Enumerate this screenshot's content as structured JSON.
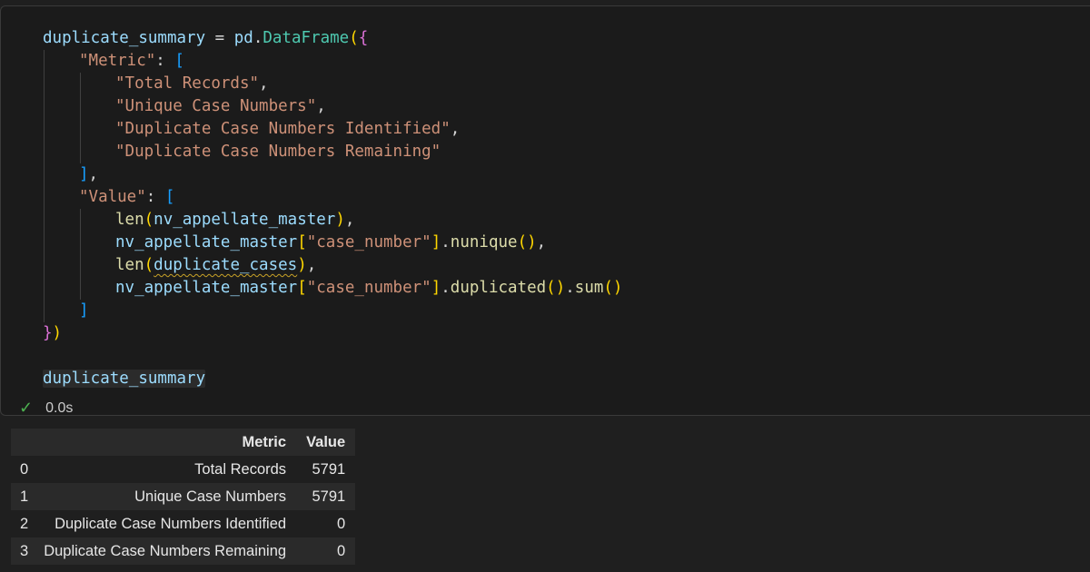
{
  "code": {
    "lines": [
      {
        "tokens": [
          {
            "t": "duplicate_summary",
            "c": "v"
          },
          {
            "t": " = ",
            "c": "op"
          },
          {
            "t": "pd",
            "c": "v"
          },
          {
            "t": ".",
            "c": "op"
          },
          {
            "t": "DataFrame",
            "c": "cls"
          },
          {
            "t": "(",
            "c": "b1"
          },
          {
            "t": "{",
            "c": "b2"
          }
        ],
        "indent": 0
      },
      {
        "tokens": [
          {
            "t": "\"Metric\"",
            "c": "str"
          },
          {
            "t": ": ",
            "c": "op"
          },
          {
            "t": "[",
            "c": "b3"
          }
        ],
        "indent": 1
      },
      {
        "tokens": [
          {
            "t": "\"Total Records\"",
            "c": "str"
          },
          {
            "t": ",",
            "c": "op"
          }
        ],
        "indent": 2
      },
      {
        "tokens": [
          {
            "t": "\"Unique Case Numbers\"",
            "c": "str"
          },
          {
            "t": ",",
            "c": "op"
          }
        ],
        "indent": 2
      },
      {
        "tokens": [
          {
            "t": "\"Duplicate Case Numbers Identified\"",
            "c": "str"
          },
          {
            "t": ",",
            "c": "op"
          }
        ],
        "indent": 2
      },
      {
        "tokens": [
          {
            "t": "\"Duplicate Case Numbers Remaining\"",
            "c": "str"
          }
        ],
        "indent": 2
      },
      {
        "tokens": [
          {
            "t": "]",
            "c": "b3"
          },
          {
            "t": ",",
            "c": "op"
          }
        ],
        "indent": 1
      },
      {
        "tokens": [
          {
            "t": "\"Value\"",
            "c": "str"
          },
          {
            "t": ": ",
            "c": "op"
          },
          {
            "t": "[",
            "c": "b3"
          }
        ],
        "indent": 1
      },
      {
        "tokens": [
          {
            "t": "len",
            "c": "fn"
          },
          {
            "t": "(",
            "c": "b1"
          },
          {
            "t": "nv_appellate_master",
            "c": "v"
          },
          {
            "t": ")",
            "c": "b1"
          },
          {
            "t": ",",
            "c": "op"
          }
        ],
        "indent": 2
      },
      {
        "tokens": [
          {
            "t": "nv_appellate_master",
            "c": "v"
          },
          {
            "t": "[",
            "c": "b1"
          },
          {
            "t": "\"case_number\"",
            "c": "str"
          },
          {
            "t": "]",
            "c": "b1"
          },
          {
            "t": ".",
            "c": "op"
          },
          {
            "t": "nunique",
            "c": "fn"
          },
          {
            "t": "()",
            "c": "b1"
          },
          {
            "t": ",",
            "c": "op"
          }
        ],
        "indent": 2
      },
      {
        "tokens": [
          {
            "t": "len",
            "c": "fn"
          },
          {
            "t": "(",
            "c": "b1"
          },
          {
            "t": "duplicate_cases",
            "c": "v squig"
          },
          {
            "t": ")",
            "c": "b1"
          },
          {
            "t": ",",
            "c": "op"
          }
        ],
        "indent": 2
      },
      {
        "tokens": [
          {
            "t": "nv_appellate_master",
            "c": "v"
          },
          {
            "t": "[",
            "c": "b1"
          },
          {
            "t": "\"case_number\"",
            "c": "str"
          },
          {
            "t": "]",
            "c": "b1"
          },
          {
            "t": ".",
            "c": "op"
          },
          {
            "t": "duplicated",
            "c": "fn"
          },
          {
            "t": "()",
            "c": "b1"
          },
          {
            "t": ".",
            "c": "op"
          },
          {
            "t": "sum",
            "c": "fn"
          },
          {
            "t": "()",
            "c": "b1"
          }
        ],
        "indent": 2
      },
      {
        "tokens": [
          {
            "t": "]",
            "c": "b3"
          }
        ],
        "indent": 1
      },
      {
        "tokens": [
          {
            "t": "}",
            "c": "b2"
          },
          {
            "t": ")",
            "c": "b1"
          }
        ],
        "indent": 0
      },
      {
        "tokens": [],
        "indent": 0
      },
      {
        "tokens": [
          {
            "t": "duplicate_summary",
            "c": "v last-expr"
          }
        ],
        "indent": 0
      }
    ]
  },
  "status": {
    "icon": "check-icon",
    "time": "0.0s",
    "color": "#4caf50"
  },
  "output_table": {
    "columns": [
      "",
      "Metric",
      "Value"
    ],
    "rows": [
      {
        "index": "0",
        "metric": "Total Records",
        "value": "5791"
      },
      {
        "index": "1",
        "metric": "Unique Case Numbers",
        "value": "5791"
      },
      {
        "index": "2",
        "metric": "Duplicate Case Numbers Identified",
        "value": "0"
      },
      {
        "index": "3",
        "metric": "Duplicate Case Numbers Remaining",
        "value": "0"
      }
    ]
  }
}
